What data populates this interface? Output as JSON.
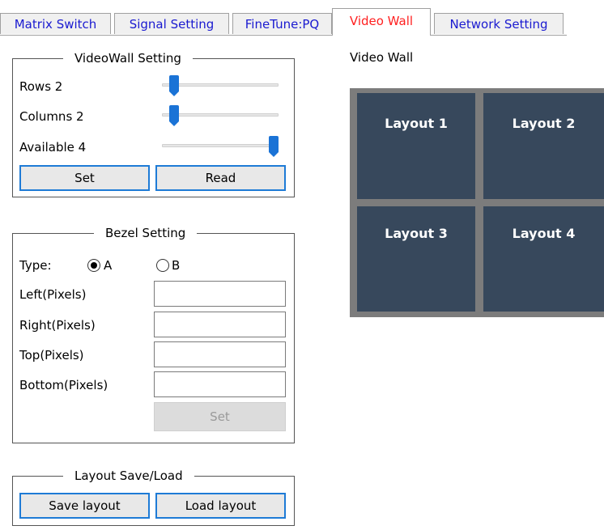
{
  "tabs": [
    {
      "label": "Matrix Switch",
      "active": false
    },
    {
      "label": "Signal Setting",
      "active": false
    },
    {
      "label": "FineTune:PQ",
      "active": false
    },
    {
      "label": "Video Wall",
      "active": true
    },
    {
      "label": "Network Setting",
      "active": false
    }
  ],
  "videowall_setting": {
    "title": "VideoWall Setting",
    "rows_label": "Rows 2",
    "columns_label": "Columns 2",
    "available_label": "Available 4",
    "rows_level": 0.1,
    "columns_level": 0.1,
    "available_level": 1.0,
    "set_label": "Set",
    "read_label": "Read"
  },
  "bezel_setting": {
    "title": "Bezel Setting",
    "type_label": "Type:",
    "option_a": "A",
    "option_b": "B",
    "selected": "A",
    "left_label": "Left(Pixels)",
    "right_label": "Right(Pixels)",
    "top_label": "Top(Pixels)",
    "bottom_label": "Bottom(Pixels)",
    "left_value": "",
    "right_value": "",
    "top_value": "",
    "bottom_value": "",
    "set_label": "Set"
  },
  "layout_save_load": {
    "title": "Layout Save/Load",
    "save_label": "Save layout",
    "load_label": "Load layout"
  },
  "video_wall": {
    "title": "Video Wall",
    "cells": [
      "Layout 1",
      "Layout 2",
      "Layout 3",
      "Layout 4"
    ]
  },
  "colors": {
    "tab_text": "#1a1ad0",
    "active_tab_text": "#ff2020",
    "button_border": "#1e7bd6",
    "slider_thumb": "#1a73d6",
    "wall_cell": "#37485c",
    "wall_frame": "#7c7c7c"
  }
}
